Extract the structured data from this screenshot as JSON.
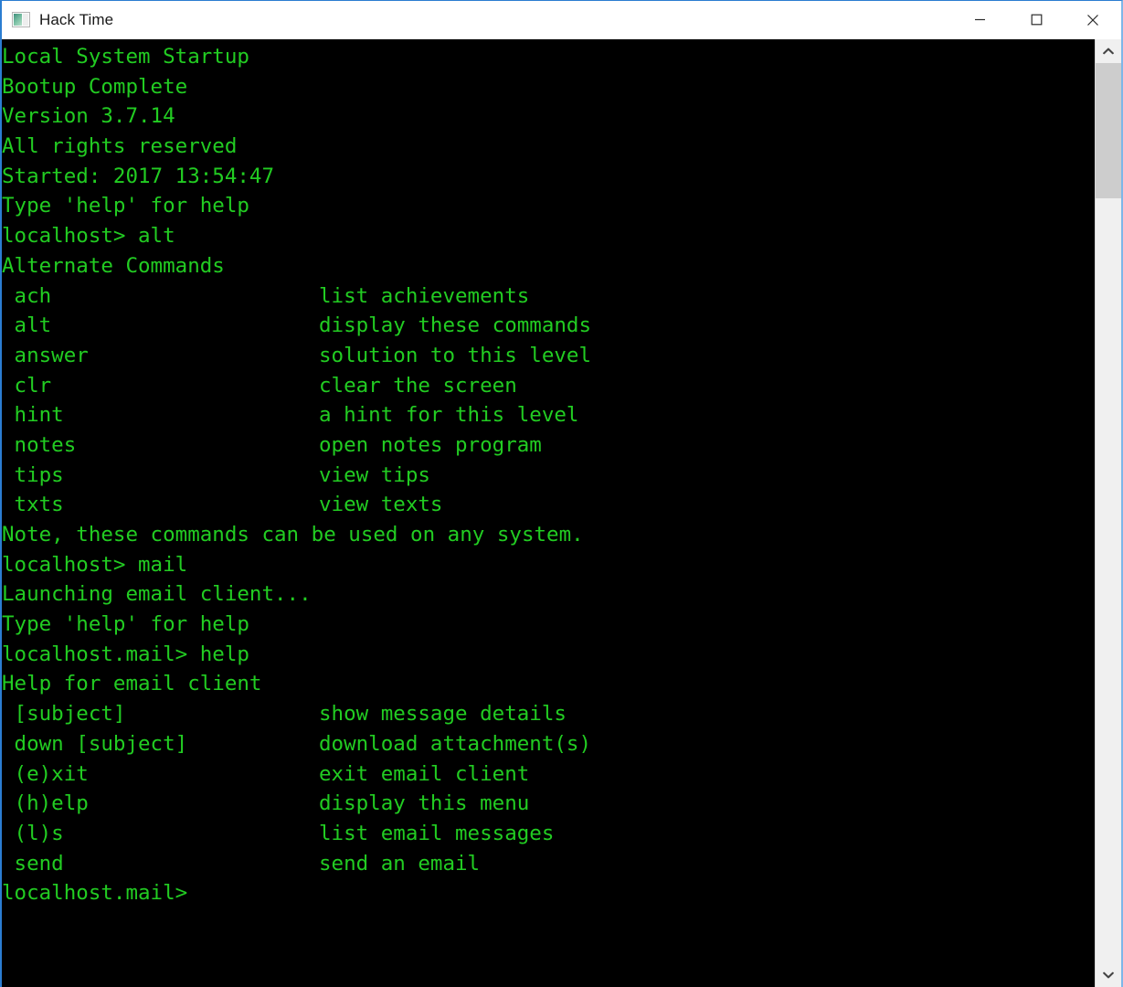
{
  "window": {
    "title": "Hack Time",
    "icon": "app-window-icon",
    "controls": {
      "minimize": "minimize-button",
      "maximize": "maximize-button",
      "close": "close-button"
    }
  },
  "colors": {
    "terminal_background": "#000000",
    "terminal_text": "#22cc22",
    "window_border": "#2b7dd1",
    "titlebar_background": "#ffffff",
    "scrollbar_track": "#f0f0f0",
    "scrollbar_thumb": "#cdcdcd"
  },
  "terminal": {
    "boot_lines": [
      "Local System Startup",
      "Bootup Complete",
      "Version 3.7.14",
      "All rights reserved",
      "Started: 2017 13:54:47",
      "Type 'help' for help"
    ],
    "prompt_alt": "localhost> alt",
    "alt_header": "Alternate Commands",
    "alt_commands": [
      {
        "cmd": " ach",
        "desc": "list achievements"
      },
      {
        "cmd": " alt",
        "desc": "display these commands"
      },
      {
        "cmd": " answer",
        "desc": "solution to this level"
      },
      {
        "cmd": " clr",
        "desc": "clear the screen"
      },
      {
        "cmd": " hint",
        "desc": "a hint for this level"
      },
      {
        "cmd": " notes",
        "desc": "open notes program"
      },
      {
        "cmd": " tips",
        "desc": "view tips"
      },
      {
        "cmd": " txts",
        "desc": "view texts"
      }
    ],
    "alt_note": "Note, these commands can be used on any system.",
    "prompt_mail": "localhost> mail",
    "mail_launch_lines": [
      "Launching email client...",
      "Type 'help' for help"
    ],
    "prompt_mail_help": "localhost.mail> help",
    "mail_header": "Help for email client",
    "mail_commands": [
      {
        "cmd": " [subject]",
        "desc": "show message details"
      },
      {
        "cmd": " down [subject]",
        "desc": "download attachment(s)"
      },
      {
        "cmd": " (e)xit",
        "desc": "exit email client"
      },
      {
        "cmd": " (h)elp",
        "desc": "display this menu"
      },
      {
        "cmd": " (l)s",
        "desc": "list email messages"
      },
      {
        "cmd": " send",
        "desc": "send an email"
      }
    ],
    "prompt_current": "localhost.mail>"
  },
  "scrollbar": {
    "up_arrow": "chevron-up-icon",
    "down_arrow": "chevron-down-icon",
    "thumb_position_percent": 0,
    "thumb_size_percent": 15
  }
}
